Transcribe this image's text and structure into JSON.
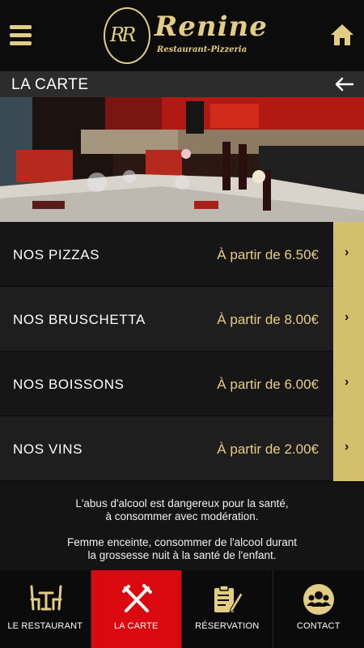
{
  "header": {
    "logo_monogram": "RR",
    "logo_name": "Renine",
    "logo_subtitle": "Restaurant-Pizzeria"
  },
  "titlebar": {
    "title": "LA CARTE"
  },
  "menu": [
    {
      "label": "NOS PIZZAS",
      "price": "À partir de 6.50€"
    },
    {
      "label": "NOS BRUSCHETTA",
      "price": "À partir de 8.00€"
    },
    {
      "label": "NOS BOISSONS",
      "price": "À partir de 6.00€"
    },
    {
      "label": "NOS VINS",
      "price": "À partir de 2.00€"
    }
  ],
  "notice": {
    "line1": "L'abus d'alcool est dangereux pour la santé,",
    "line2": "à consommer avec modération.",
    "line3": "Femme enceinte, consommer de l'alcool durant",
    "line4": "la grossesse nuit à la santé de l'enfant."
  },
  "tabs": [
    {
      "label": "LE RESTAURANT",
      "icon": "table-chairs-icon"
    },
    {
      "label": "LA CARTE",
      "icon": "fork-knife-icon",
      "active": true
    },
    {
      "label": "RÉSERVATION",
      "icon": "clipboard-pen-icon"
    },
    {
      "label": "CONTACT",
      "icon": "people-icon"
    }
  ],
  "colors": {
    "accent_gold": "#e3cd84",
    "active_red": "#d9090f",
    "arrow_gold": "#d4bf6c"
  }
}
